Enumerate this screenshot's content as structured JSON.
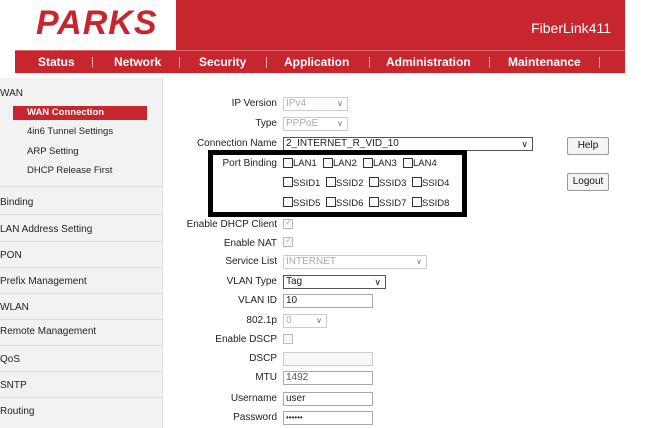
{
  "brand": {
    "logo": "PARKS",
    "product": "FiberLink411"
  },
  "nav": {
    "items": [
      "Status",
      "Network",
      "Security",
      "Application",
      "Administration",
      "Maintenance"
    ],
    "active": "Network"
  },
  "sidebar": {
    "items": [
      {
        "label": "WAN"
      },
      {
        "label": "WAN Connection",
        "sub": true,
        "active": true
      },
      {
        "label": "4in6 Tunnel Settings",
        "sub": true
      },
      {
        "label": "ARP Setting",
        "sub": true
      },
      {
        "label": "DHCP Release First",
        "sub": true
      },
      {
        "label": "Binding"
      },
      {
        "label": "LAN Address Setting"
      },
      {
        "label": "PON"
      },
      {
        "label": "Prefix Management"
      },
      {
        "label": "WLAN"
      },
      {
        "label": "Remote Management"
      },
      {
        "label": "QoS"
      },
      {
        "label": "SNTP"
      },
      {
        "label": "Routing"
      }
    ]
  },
  "form": {
    "ip_version": {
      "label": "IP Version",
      "value": "IPv4"
    },
    "type": {
      "label": "Type",
      "value": "PPPoE"
    },
    "connection_name": {
      "label": "Connection Name",
      "value": "2_INTERNET_R_VID_10"
    },
    "port_binding": {
      "label": "Port Binding",
      "row1": [
        "LAN1",
        "LAN2",
        "LAN3",
        "LAN4"
      ],
      "row2": [
        "SSID1",
        "SSID2",
        "SSID3",
        "SSID4"
      ],
      "row3": [
        "SSID5",
        "SSID6",
        "SSID7",
        "SSID8"
      ]
    },
    "enable_dhcp_client": {
      "label": "Enable DHCP Client"
    },
    "enable_nat": {
      "label": "Enable NAT"
    },
    "service_list": {
      "label": "Service List",
      "value": "INTERNET"
    },
    "vlan_type": {
      "label": "VLAN Type",
      "value": "Tag"
    },
    "vlan_id": {
      "label": "VLAN ID",
      "value": "10"
    },
    "dot1p": {
      "label": "802.1p",
      "value": "0"
    },
    "enable_dscp": {
      "label": "Enable DSCP"
    },
    "dscp": {
      "label": "DSCP",
      "value": ""
    },
    "mtu": {
      "label": "MTU",
      "value": "1492"
    },
    "username": {
      "label": "Username",
      "value": "user"
    },
    "password": {
      "label": "Password",
      "value": "••••••"
    }
  },
  "buttons": {
    "help": "Help",
    "logout": "Logout"
  },
  "colors": {
    "brand": "#c8262e",
    "highlight_border": "#000000"
  }
}
